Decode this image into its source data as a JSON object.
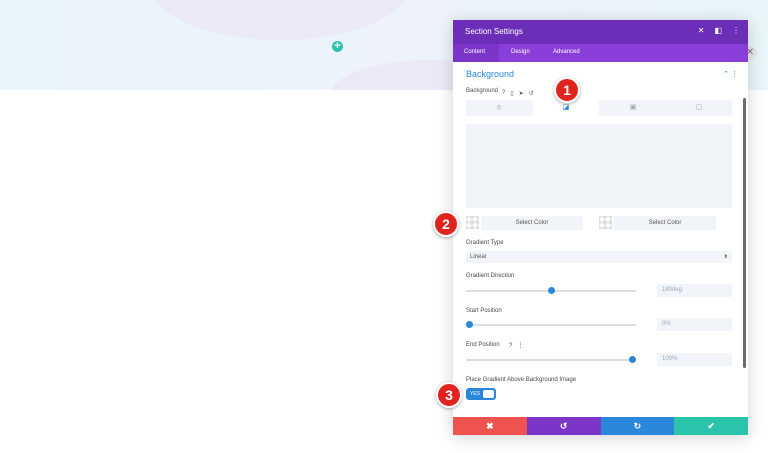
{
  "modal": {
    "title": "Section Settings",
    "header_icons": [
      "close-icon",
      "snap-icon",
      "more-icon"
    ],
    "tabs": [
      "Content",
      "Design",
      "Advanced"
    ],
    "section_title": "Background",
    "background_label": "Background",
    "bg_tabs": [
      "gradient-none-icon",
      "gradient-icon",
      "image-icon",
      "video-icon"
    ],
    "select_color_1": "Select Color",
    "select_color_2": "Select Color",
    "gradient_type_label": "Gradient Type",
    "gradient_type_value": "Linear",
    "gradient_direction_label": "Gradient Direction",
    "gradient_direction_value": "180deg",
    "start_position_label": "Start Position",
    "start_position_value": "0%",
    "end_position_label": "End Position",
    "end_position_value": "100%",
    "place_gradient_label": "Place Gradient Above Background Image",
    "toggle_label": "YES"
  },
  "markers": [
    "1",
    "2",
    "3"
  ],
  "colors": {
    "header": "#6c2eb9",
    "tabs": "#8a3ed9",
    "accent": "#2b87da",
    "footer": [
      "#ef5350",
      "#7b35c9",
      "#2b87da",
      "#29c4a9"
    ]
  }
}
